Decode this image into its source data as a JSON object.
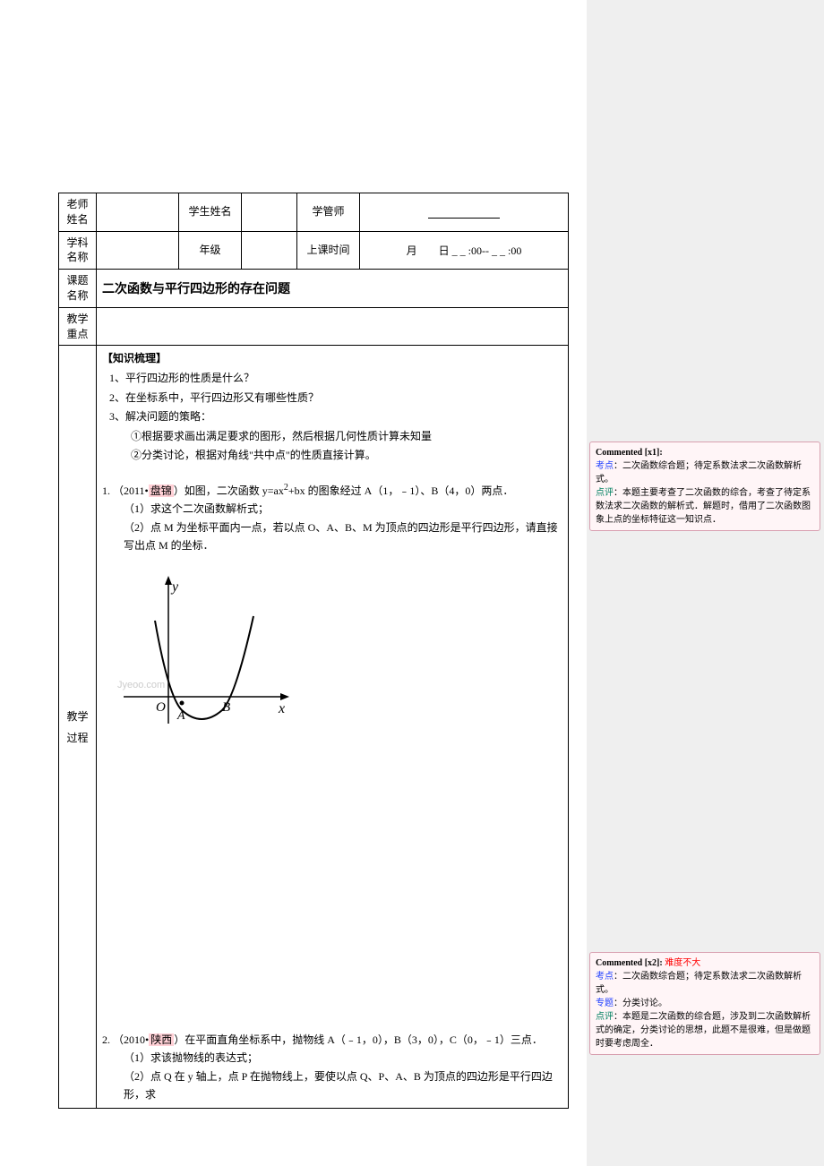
{
  "header": {
    "teacher_name_label": "老师姓名",
    "student_name_label": "学生姓名",
    "manager_label": "学管师",
    "subject_label": "学科名称",
    "grade_label": "年级",
    "class_time_label": "上课时间",
    "time_text": "月　　日 _ _ :00-- _ _ :00",
    "topic_label": "课题名称",
    "topic_value": "二次函数与平行四边形的存在问题",
    "focus_label": "教学重点",
    "process_label": "教学过程"
  },
  "knowledge": {
    "title": "【知识梳理】",
    "item1": "1、平行四边形的性质是什么？",
    "item2": "2、在坐标系中，平行四边形又有哪些性质？",
    "item3": "3、解决问题的策略：",
    "item3a": "①根据要求画出满足要求的图形，然后根据几何性质计算未知量",
    "item3b": "②分类讨论，根据对角线\"共中点\"的性质直接计算。"
  },
  "problem1": {
    "num": "1.",
    "source_prefix": "（2011•",
    "source_loc": "盘锦",
    "source_suffix": "）如图，二次函数 y=ax",
    "formula_sup": "2",
    "formula_rest": "+bx 的图象经过 A（1，﹣1）、B（4，0）两点．",
    "part1": "（1）求这个二次函数解析式；",
    "part2": "（2）点 M 为坐标平面内一点，若以点 O、A、B、M 为顶点的四边形是平行四边形，请直接写出点 M 的坐标．"
  },
  "graph": {
    "y_label": "y",
    "x_label": "x",
    "origin_label": "O",
    "point_a": "A",
    "point_b": "B",
    "watermark": "Jyeoo.com"
  },
  "problem2": {
    "num": "2.",
    "source_prefix": "（2010•",
    "source_loc": "陕西",
    "source_suffix": "）在平面直角坐标系中，抛物线 A（﹣1，0），B（3，0），C（0，﹣1）三点．",
    "part1": "（1）求该抛物线的表达式；",
    "part2": "（2）点 Q 在 y 轴上，点 P 在抛物线上，要使以点 Q、P、A、B 为顶点的四边形是平行四边形，求"
  },
  "comment1": {
    "header": "Commented [x1]:",
    "kd_label": "考点",
    "kd_text": "：二次函数综合题；待定系数法求二次函数解析式。",
    "dp_label": "点评",
    "dp_text": "：本题主要考查了二次函数的综合，考查了待定系数法求二次函数的解析式．解题时，借用了二次函数图象上点的坐标特征这一知识点．"
  },
  "comment2": {
    "header_prefix": "Commented [x2]:  ",
    "header_note": "难度不大",
    "kd_label": "考点",
    "kd_text": "：二次函数综合题；待定系数法求二次函数解析式。",
    "zt_label": "专题",
    "zt_text": "：分类讨论。",
    "dp_label": "点评",
    "dp_text": "：本题是二次函数的综合题，涉及到二次函数解析式的确定，分类讨论的思想，此题不是很难，但是做题时要考虑周全．"
  }
}
